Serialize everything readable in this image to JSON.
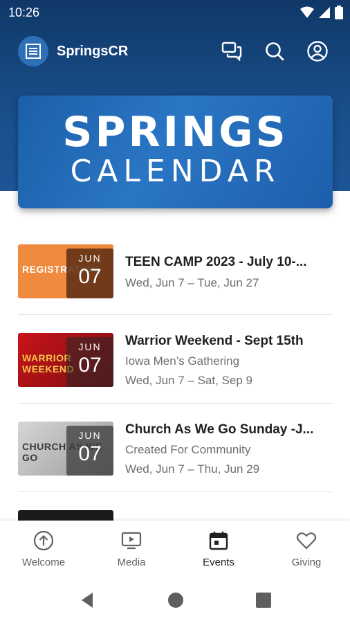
{
  "status_bar": {
    "time": "10:26"
  },
  "app_bar": {
    "title": "SpringsCR",
    "icons": [
      "logo-icon",
      "chat-icon",
      "search-icon",
      "account-icon"
    ]
  },
  "banner": {
    "line1": "SPRINGS",
    "line2": "CALENDAR"
  },
  "events": [
    {
      "thumb_caption": "REGISTRATION",
      "thumb_color": "#f08a3e",
      "month": "JUN",
      "day": "07",
      "title": "TEEN CAMP 2023 - July 10-...",
      "subtitle": "",
      "dates": "Wed, Jun 7 – Tue, Jun 27"
    },
    {
      "thumb_caption": "WARRIOR WEEKEND",
      "thumb_color": "#b3161b",
      "month": "JUN",
      "day": "07",
      "title": "Warrior Weekend - Sept 15th",
      "subtitle": "Iowa Men’s Gathering",
      "dates": "Wed, Jun 7 – Sat, Sep 9"
    },
    {
      "thumb_caption": "CHURCH AS WE GO",
      "thumb_color": "#bdbdbd",
      "month": "JUN",
      "day": "07",
      "title": "Church As We Go Sunday -J...",
      "subtitle": "Created For Community",
      "dates": "Wed, Jun 7 – Thu, Jun 29"
    }
  ],
  "bottom_nav": {
    "items": [
      {
        "label": "Welcome",
        "icon": "arrow-up-circle-icon"
      },
      {
        "label": "Media",
        "icon": "tv-play-icon"
      },
      {
        "label": "Events",
        "icon": "calendar-icon",
        "active": true
      },
      {
        "label": "Giving",
        "icon": "heart-icon"
      }
    ]
  },
  "colors": {
    "header": "#174a85",
    "accent": "#2a76c4",
    "text_secondary": "#6e6e6e"
  }
}
